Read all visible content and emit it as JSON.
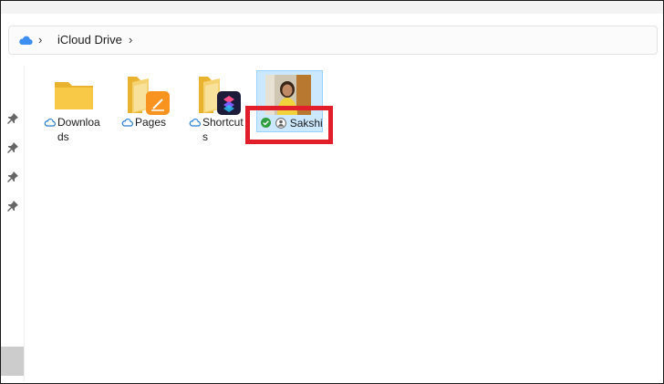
{
  "breadcrumb": {
    "location": "iCloud Drive"
  },
  "items": [
    {
      "name_line1": "Downloa",
      "name_line2": "ds",
      "type": "folder",
      "sync": "cloud"
    },
    {
      "name_line1": "Pages",
      "name_line2": "",
      "type": "folder-app",
      "sync": "cloud"
    },
    {
      "name_line1": "Shortcut",
      "name_line2": "s",
      "type": "folder-app",
      "sync": "cloud"
    },
    {
      "name_line1": "Sakshi",
      "name_line2": "",
      "type": "image",
      "sync": "synced",
      "selected": true
    }
  ],
  "colors": {
    "accent": "#1a73e8",
    "highlight": "#e21e2b",
    "selection": "#cce8ff",
    "folder": "#f8c847"
  }
}
